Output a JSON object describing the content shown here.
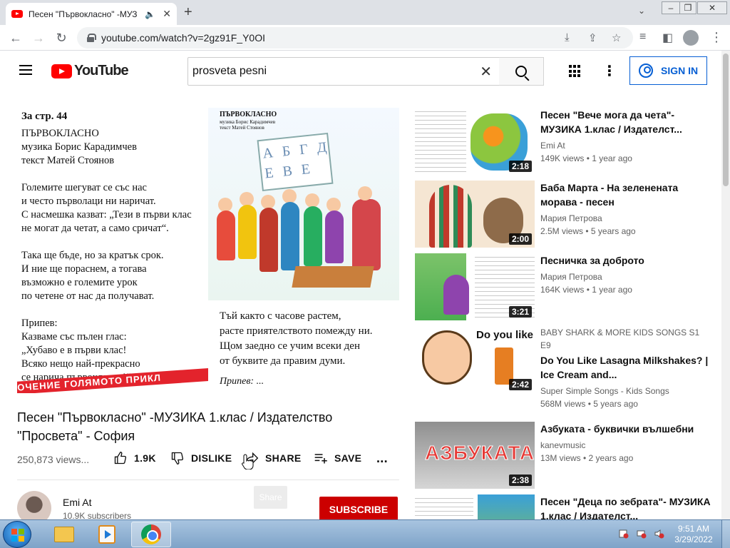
{
  "browser": {
    "tab_title": "Песен \"Първокласно\" -МУЗ",
    "url": "youtube.com/watch?v=2gz91F_Y0OI"
  },
  "header": {
    "logo_text": "YouTube",
    "search_value": "prosveta pesni",
    "signin_label": "SIGN IN"
  },
  "video": {
    "left_page": {
      "page_ref": "За стр. 44",
      "body": "ПЪРВОКЛАСНО\nмузика Борис Карадимчев\nтекст Матей Стоянов\n\nГолемите шегуват се със нас\nи често първолаци ни наричат.\nС насмешка казват: „Тези в първи клас\nне могат да четат, а само сричат“.\n\nТака ще бъде, но за кратък срок.\nИ ние ще пораснем, а тогава\nвъзможно е големите урок\nпо четене от нас да получават.\n\nПрипев:\nКазваме със пълен глас:\n„Хубаво е в първи клас!\nВсяко нещо най-прекрасно\nсе нарича първокласно!“."
    },
    "right_page": {
      "illus_title": "ПЪРВОКЛАСНО",
      "illus_sub": "музика Борис Карадимчев\nтекст Матей Стоянов",
      "board_letters": "А Б Г Д\nЕ В Е",
      "verse": "Тъй както с часове растем,\nрасте приятелството помежду ни.\nЩом заедно се учим всеки ден\nот буквите да правим думи.",
      "chorus": "Припев: ...",
      "banner": "ОЧЕНИЕ  ГОЛЯМОТО ПРИКЛ"
    },
    "title": "Песен \"Първокласно\" -МУЗИКА 1.клас / Издателство \"Просвета\" - София",
    "views": "250,873 views...",
    "actions": {
      "like": "1.9K",
      "dislike": "DISLIKE",
      "share": "SHARE",
      "save": "SAVE",
      "more": "..."
    },
    "channel": {
      "name": "Emi At",
      "subscribers": "10.9K subscribers"
    },
    "share_tooltip": "Share",
    "subscribe_label": "SUBSCRIBE"
  },
  "related": [
    {
      "title": "Песен \"Вече мога да чета\"- МУЗИКА 1.клас / Издателст...",
      "channel": "Emi At",
      "meta": "149K views • 1 year ago",
      "duration": "2:18",
      "colors": [
        "#8cc63f",
        "#f7941d",
        "#ffffff"
      ]
    },
    {
      "title": "Баба Марта - На зеленената морава - песен",
      "channel": "Мария Петрова",
      "meta": "2.5M views • 5 years ago",
      "duration": "2:00",
      "colors": [
        "#c0392b",
        "#f5e6d3",
        "#2e8b57"
      ]
    },
    {
      "title": "Песничка за доброто",
      "channel": "Мария Петрова",
      "meta": "164K views • 1 year ago",
      "duration": "3:21",
      "colors": [
        "#4caf50",
        "#8e44ad",
        "#ffffff"
      ]
    },
    {
      "tag": "BABY SHARK & MORE KIDS SONGS  S1 E9",
      "title": "Do You Like Lasagna Milkshakes? | Ice Cream and...",
      "channel": "Super Simple Songs - Kids Songs",
      "meta": "568M views • 5 years ago",
      "duration": "2:42",
      "thumb_text": "Do you like",
      "colors": [
        "#ffffff",
        "#e67e22",
        "#2e7d32"
      ]
    },
    {
      "title": "Азбуката - буквички вълшебни",
      "channel": "kanevmusic",
      "meta": "13M views • 2 years ago",
      "duration": "2:38",
      "thumb_text": "АЗБУКАТА",
      "colors": [
        "#9e9e9e",
        "#e53935",
        "#ffffff"
      ]
    },
    {
      "title": "Песен \"Деца по зебрата\"- МУЗИКА 1.клас / Издателст...",
      "colors": [
        "#ffffff",
        "#3aa0d8",
        "#8bc34a"
      ]
    }
  ],
  "taskbar": {
    "time": "9:51 AM",
    "date": "3/29/2022"
  }
}
